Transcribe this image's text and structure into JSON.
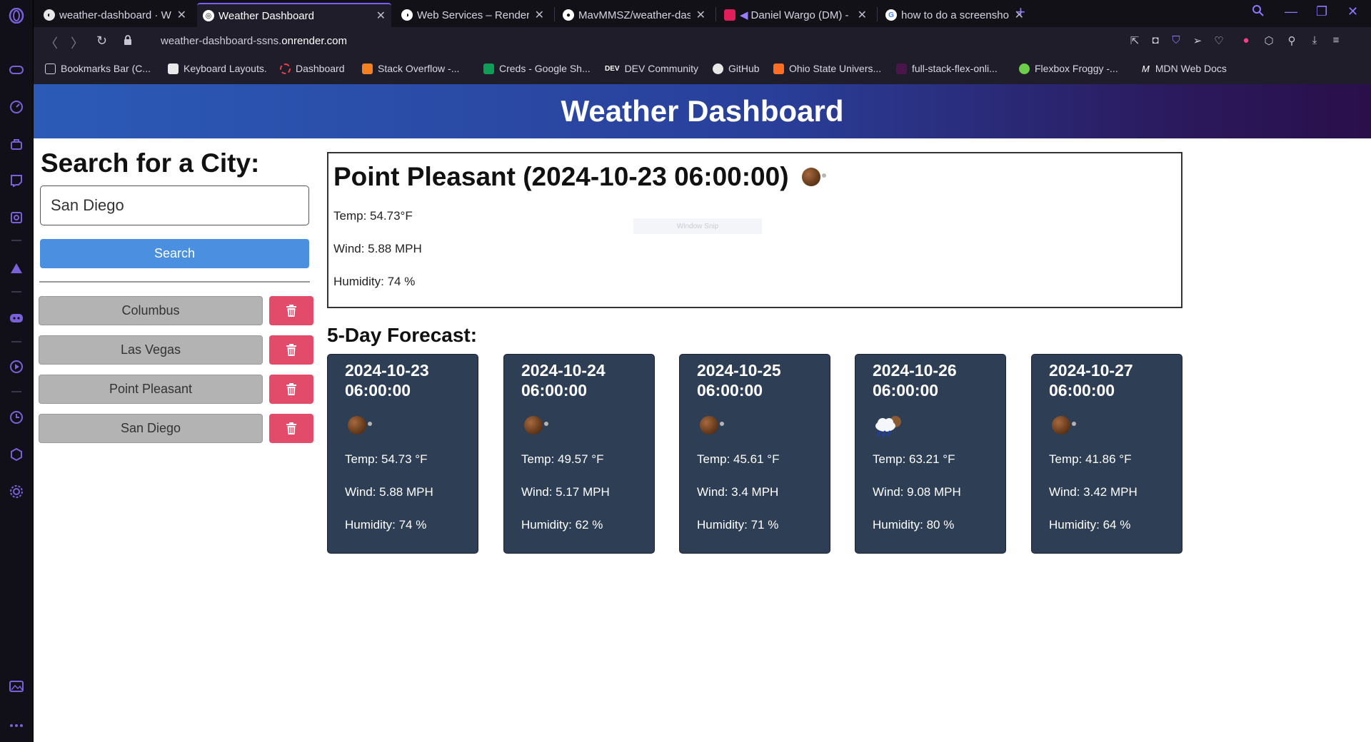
{
  "browser": {
    "tabs": [
      {
        "title": "weather-dashboard · We",
        "active": false
      },
      {
        "title": "Weather Dashboard",
        "active": true
      },
      {
        "title": "Web Services – Render D",
        "active": false
      },
      {
        "title": "MavMMSZ/weather-dasl",
        "active": false
      },
      {
        "title": "Daniel Wargo (DM) - ",
        "active": false
      },
      {
        "title": "how to do a screenshot c",
        "active": false
      }
    ],
    "url_prefix": "weather-dashboard-ssns.",
    "url_host": "onrender.com",
    "bookmarks": [
      "Bookmarks Bar (C...",
      "Keyboard Layouts.",
      "Dashboard",
      "Stack Overflow -...",
      "Creds - Google Sh...",
      "DEV Community",
      "GitHub",
      "Ohio State Univers...",
      "full-stack-flex-onli...",
      "Flexbox Froggy -...",
      "MDN Web Docs"
    ],
    "bookmark_prefix_dev": "DEV",
    "bookmark_prefix_mdn": "M",
    "accent": "#7a5cff"
  },
  "page": {
    "header_title": "Weather Dashboard",
    "search_title": "Search for a City:",
    "search_value": "San Diego",
    "search_button": "Search",
    "history": [
      "Columbus",
      "Las Vegas",
      "Point Pleasant",
      "San Diego"
    ],
    "current": {
      "title": "Point Pleasant (2024-10-23 06:00:00)",
      "temp": "Temp: 54.73°F",
      "wind": "Wind: 5.88 MPH",
      "humidity": "Humidity: 74 %",
      "icon": "night-clear-moon-icon"
    },
    "snip_overlay": "Window Snip",
    "forecast_title": "5-Day Forecast:",
    "forecast": [
      {
        "date": "2024-10-23",
        "time": "06:00:00",
        "temp": "Temp: 54.73 °F",
        "wind": "Wind: 5.88 MPH",
        "humidity": "Humidity: 74 %",
        "icon": "night-clear-moon-icon"
      },
      {
        "date": "2024-10-24",
        "time": "06:00:00",
        "temp": "Temp: 49.57 °F",
        "wind": "Wind: 5.17 MPH",
        "humidity": "Humidity: 62 %",
        "icon": "night-clear-moon-icon"
      },
      {
        "date": "2024-10-25",
        "time": "06:00:00",
        "temp": "Temp: 45.61 °F",
        "wind": "Wind: 3.4 MPH",
        "humidity": "Humidity: 71 %",
        "icon": "night-clear-moon-icon"
      },
      {
        "date": "2024-10-26",
        "time": "06:00:00",
        "temp": "Temp: 63.21 °F",
        "wind": "Wind: 9.08 MPH",
        "humidity": "Humidity: 80 %",
        "icon": "night-rain-cloud-icon"
      },
      {
        "date": "2024-10-27",
        "time": "06:00:00",
        "temp": "Temp: 41.86 °F",
        "wind": "Wind: 3.42 MPH",
        "humidity": "Humidity: 64 %",
        "icon": "night-clear-moon-icon"
      }
    ],
    "colors": {
      "search_button": "#4a8fe0",
      "delete_button": "#e24c6a",
      "history_button": "#b3b3b3",
      "card_bg": "#2d3e55"
    }
  }
}
